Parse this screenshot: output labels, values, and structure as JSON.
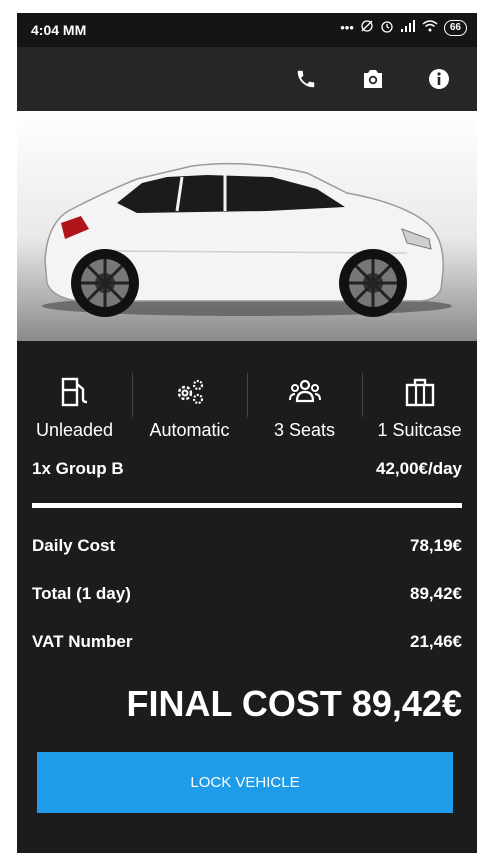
{
  "status_bar": {
    "time": "4:04 MM",
    "icons": [
      "dots-icon",
      "alarm-off-icon",
      "alarm-icon",
      "signal-icon",
      "wifi-icon",
      "battery-icon"
    ],
    "battery": "66"
  },
  "app_bar": {
    "actions": [
      "phone-icon",
      "camera-icon",
      "info-icon"
    ]
  },
  "features": [
    {
      "icon": "fuel-pump-icon",
      "label": "Unleaded"
    },
    {
      "icon": "gears-icon",
      "label": "Automatic"
    },
    {
      "icon": "people-icon",
      "label": "3 Seats"
    },
    {
      "icon": "suitcase-icon",
      "label": "1 Suitcase"
    }
  ],
  "group": {
    "label": "1x Group B",
    "price": "42,00€/day"
  },
  "costs": [
    {
      "label": "Daily Cost",
      "value": "78,19€"
    },
    {
      "label": "Total (1 day)",
      "value": "89,42€"
    },
    {
      "label": "VAT Number",
      "value": "21,46€"
    }
  ],
  "final_cost": "FINAL COST 89,42€",
  "lock_button": "LOCK VEHICLE",
  "colors": {
    "background": "#1c1c1c",
    "app_bar": "#272727",
    "accent": "#1e9be9",
    "text": "#ffffff"
  }
}
